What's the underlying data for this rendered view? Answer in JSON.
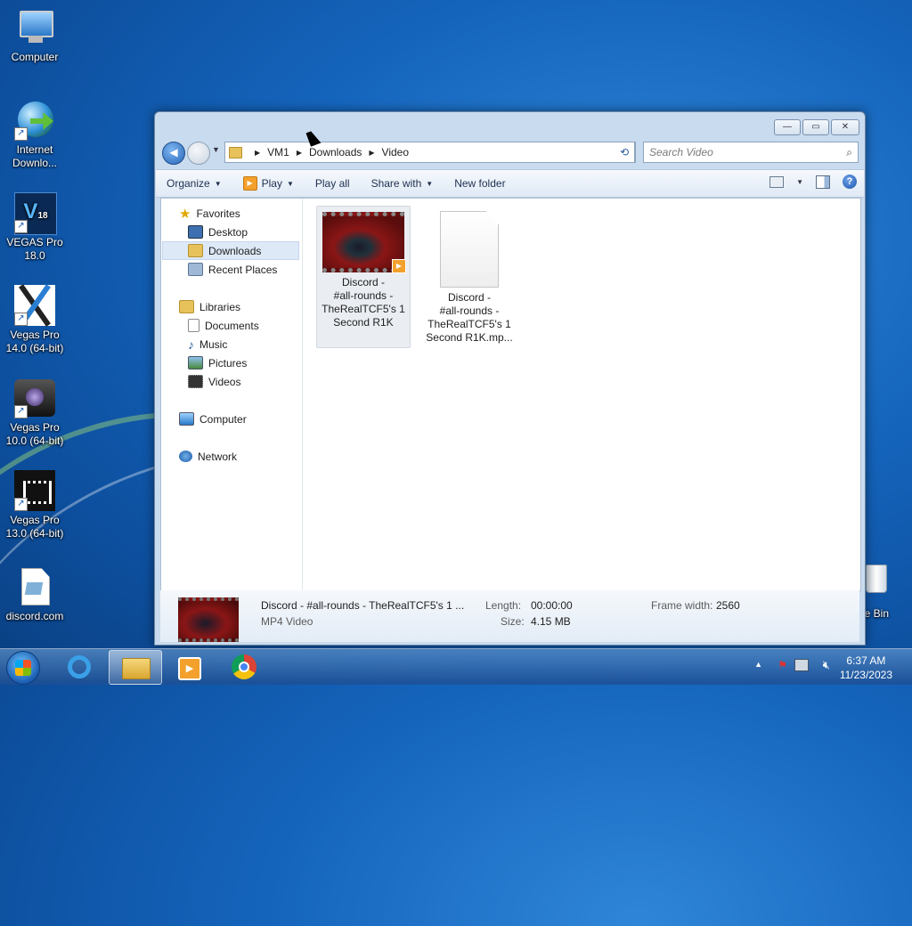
{
  "desktop": {
    "icons": [
      {
        "label": "Computer"
      },
      {
        "label": "Internet Downlo..."
      },
      {
        "label": "VEGAS Pro 18.0"
      },
      {
        "label": "Vegas Pro 14.0 (64-bit)"
      },
      {
        "label": "Vegas Pro 10.0 (64-bit)"
      },
      {
        "label": "Vegas Pro 13.0 (64-bit)"
      },
      {
        "label": "discord.com"
      },
      {
        "label": "cle Bin"
      }
    ]
  },
  "window": {
    "controls": {
      "minimize": "—",
      "maximize": "▭",
      "close": "✕"
    },
    "breadcrumb": [
      "VM1",
      "Downloads",
      "Video"
    ],
    "search_placeholder": "Search Video",
    "toolbar": {
      "organize": "Organize",
      "play": "Play",
      "play_all": "Play all",
      "share_with": "Share with",
      "new_folder": "New folder"
    },
    "nav": {
      "favorites": "Favorites",
      "desktop": "Desktop",
      "downloads": "Downloads",
      "recent_places": "Recent Places",
      "libraries": "Libraries",
      "documents": "Documents",
      "music": "Music",
      "pictures": "Pictures",
      "videos": "Videos",
      "computer": "Computer",
      "network": "Network"
    },
    "files": [
      {
        "line1": "Discord -",
        "line2": "#all-rounds -",
        "line3": "TheRealTCF5's 1",
        "line4": "Second R1K"
      },
      {
        "line1": "Discord -",
        "line2": "#all-rounds -",
        "line3": "TheRealTCF5's 1",
        "line4": "Second R1K.mp..."
      }
    ],
    "details": {
      "name": "Discord - #all-rounds - TheRealTCF5's 1 ...",
      "type": "MP4 Video",
      "length_label": "Length:",
      "length_value": "00:00:00",
      "size_label": "Size:",
      "size_value": "4.15 MB",
      "frame_width_label": "Frame width:",
      "frame_width_value": "2560"
    }
  },
  "taskbar": {
    "time": "6:37 AM",
    "date": "11/23/2023"
  },
  "colors": {
    "desktop_blue": "#1565bd",
    "window_frame": "#c9dbee",
    "selected_nav": "#dde9f7"
  }
}
